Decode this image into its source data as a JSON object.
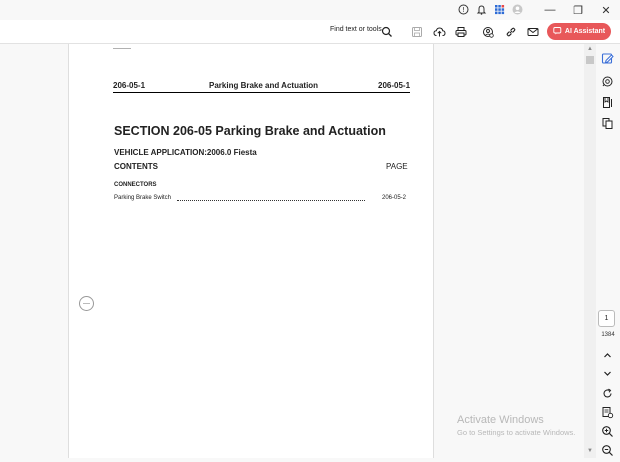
{
  "titlebar": {
    "icons": [
      "help-icon",
      "bell-icon",
      "apps-grid-icon",
      "avatar"
    ],
    "window_buttons": {
      "minimize": "—",
      "restore": "❐",
      "close": "✕"
    }
  },
  "toolbar": {
    "find_text": "Find text or tools",
    "tools": [
      "save-icon",
      "upload-icon",
      "print-icon",
      "share-icon",
      "link-icon",
      "email-icon"
    ],
    "ai_label": "AI Assistant"
  },
  "document": {
    "header_left": "206-05-1",
    "header_center": "Parking Brake and Actuation",
    "header_right": "206-05-1",
    "section_title": "SECTION 206-05 Parking Brake and Actuation",
    "vehicle_application": "VEHICLE APPLICATION:2006.0 Fiesta",
    "contents_label": "CONTENTS",
    "page_label": "PAGE",
    "connectors_label": "CONNECTORS",
    "entries": [
      {
        "name": "Parking Brake Switch",
        "page": "206-05-2"
      }
    ]
  },
  "navigation": {
    "current_page": "1",
    "total_pages": "1384"
  },
  "watermark": {
    "title": "Activate Windows",
    "subtitle": "Go to Settings to activate Windows."
  },
  "colors": {
    "ai_button": "#e8585a",
    "accent": "#3b6fd8"
  }
}
